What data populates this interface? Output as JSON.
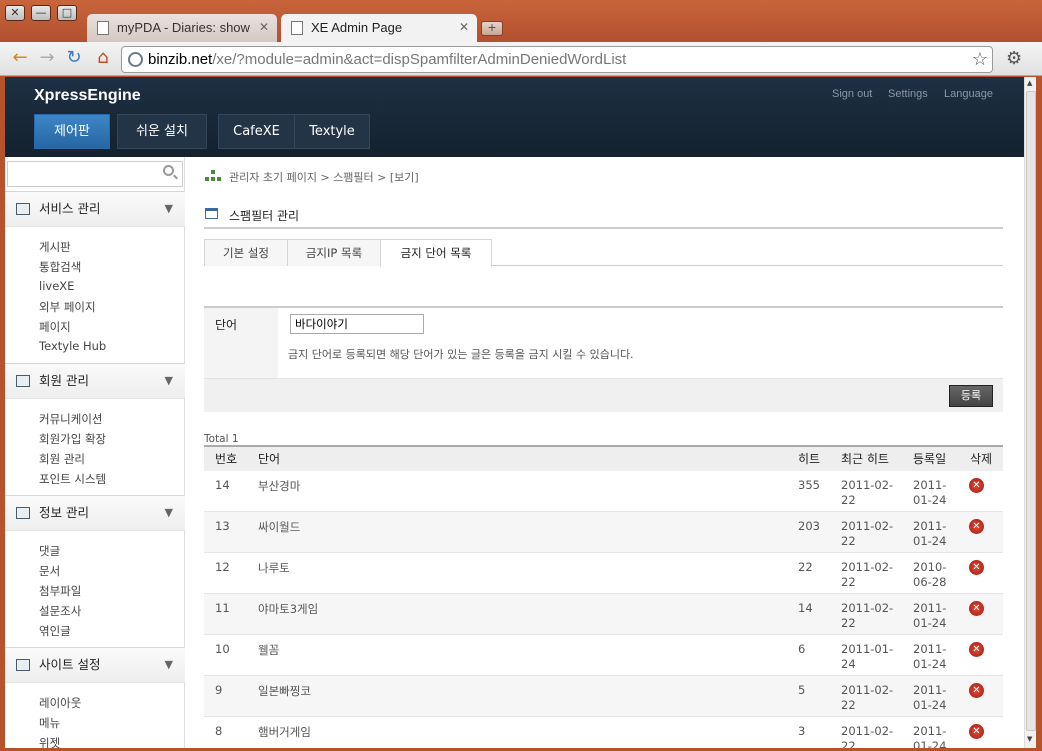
{
  "window": {
    "close": "✕",
    "minimize": "—",
    "maximize": "□",
    "tabs": [
      {
        "title": "myPDA - Diaries: show"
      },
      {
        "title": "XE Admin Page"
      }
    ],
    "new_tab": "+"
  },
  "toolbar": {
    "back": "←",
    "forward": "→",
    "reload": "↻",
    "home": "⌂",
    "url_host": "binzib.net",
    "url_path": "/xe/?module=admin&act=dispSpamfilterAdminDeniedWordList",
    "bookmark": "☆",
    "wrench": "🔧"
  },
  "header": {
    "logo": "XpressEngine",
    "links": [
      "Sign out",
      "Settings",
      "Language"
    ],
    "menu": [
      "제어판",
      "쉬운 설치",
      "CafeXE",
      "Textyle"
    ]
  },
  "sidebar": {
    "search_placeholder": "",
    "sections": [
      {
        "title": "서비스 관리",
        "items": [
          "게시판",
          "통합검색",
          "liveXE",
          "외부 페이지",
          "페이지",
          "Textyle Hub"
        ]
      },
      {
        "title": "회원 관리",
        "items": [
          "커뮤니케이션",
          "회원가입 확장",
          "회원 관리",
          "포인트 시스템"
        ]
      },
      {
        "title": "정보 관리",
        "items": [
          "댓글",
          "문서",
          "첨부파일",
          "설문조사",
          "엮인글"
        ]
      },
      {
        "title": "사이트 설정",
        "items": [
          "레이아웃",
          "메뉴",
          "위젯"
        ]
      }
    ]
  },
  "breadcrumb": "관리자 초기 페이지 > 스팸필터 > [보기]",
  "page_title": "스팸필터 관리",
  "tabs": [
    "기본 설정",
    "금지IP 목록",
    "금지 단어 목록"
  ],
  "form": {
    "label": "단어",
    "value": "바다이야기",
    "help": "금지 단어로 등록되면 해당 단어가 있는 글은 등록을 금지 시킬 수 있습니다.",
    "submit": "등록"
  },
  "total": "Total 1",
  "table": {
    "headers": [
      "번호",
      "단어",
      "히트",
      "최근 히트",
      "등록일",
      "삭제"
    ],
    "rows": [
      {
        "no": "14",
        "word": "부산경마",
        "hits": "355",
        "last_a": "2011-02-",
        "last_b": "22",
        "reg_a": "2011-",
        "reg_b": "01-24"
      },
      {
        "no": "13",
        "word": "싸이월드",
        "hits": "203",
        "last_a": "2011-02-",
        "last_b": "22",
        "reg_a": "2011-",
        "reg_b": "01-24"
      },
      {
        "no": "12",
        "word": "나루토",
        "hits": "22",
        "last_a": "2011-02-",
        "last_b": "22",
        "reg_a": "2010-",
        "reg_b": "06-28"
      },
      {
        "no": "11",
        "word": "야마토3게임",
        "hits": "14",
        "last_a": "2011-02-",
        "last_b": "22",
        "reg_a": "2011-",
        "reg_b": "01-24"
      },
      {
        "no": "10",
        "word": "웰꼼",
        "hits": "6",
        "last_a": "2011-01-",
        "last_b": "24",
        "reg_a": "2011-",
        "reg_b": "01-24"
      },
      {
        "no": "9",
        "word": "일본빠찡코",
        "hits": "5",
        "last_a": "2011-02-",
        "last_b": "22",
        "reg_a": "2011-",
        "reg_b": "01-24"
      },
      {
        "no": "8",
        "word": "햄버거게임",
        "hits": "3",
        "last_a": "2011-02-",
        "last_b": "22",
        "reg_a": "2011-",
        "reg_b": "01-24"
      }
    ]
  },
  "colors": {
    "header_bg": "#1b2a3a",
    "active_menu": "#2f76b6",
    "frame": "#b5532d"
  }
}
